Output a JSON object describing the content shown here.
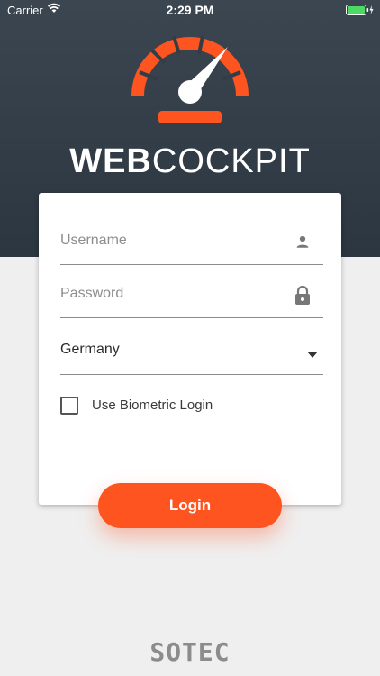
{
  "status_bar": {
    "carrier": "Carrier",
    "time": "2:29 PM"
  },
  "brand": {
    "bold": "WEB",
    "light": "COCKPIT"
  },
  "form": {
    "username_placeholder": "Username",
    "password_placeholder": "Password",
    "country_value": "Germany",
    "biometric_label": "Use Biometric Login",
    "biometric_checked": false,
    "login_label": "Login"
  },
  "footer": {
    "company": "SOTEC"
  },
  "colors": {
    "accent": "#fe5420",
    "header_bg": "#323d47",
    "page_bg": "#efefef"
  },
  "icons": {
    "username": "person-icon",
    "password": "lock-icon",
    "country": "dropdown-arrow-icon",
    "logo": "speedometer-logo-icon"
  }
}
